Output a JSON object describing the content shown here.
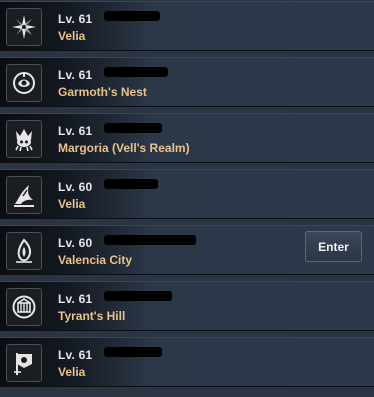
{
  "servers": [
    {
      "level": "Lv. 61",
      "name": "Velia",
      "icon": "star-compass-icon"
    },
    {
      "level": "Lv. 61",
      "name": "Garmoth's Nest",
      "icon": "dragon-eye-icon"
    },
    {
      "level": "Lv. 61",
      "name": "Margoria (Vell's Realm)",
      "icon": "kraken-crest-icon"
    },
    {
      "level": "Lv. 60",
      "name": "Velia",
      "icon": "wing-crest-icon"
    },
    {
      "level": "Lv. 60",
      "name": "Valencia City",
      "icon": "flame-crest-icon",
      "enter_label": "Enter"
    },
    {
      "level": "Lv. 61",
      "name": "Tyrant's Hill",
      "icon": "fortress-gate-icon"
    },
    {
      "level": "Lv. 61",
      "name": "Velia",
      "icon": "banner-crest-icon"
    }
  ],
  "colors": {
    "server_name": "#e9c38a",
    "level_text": "#e8e8e8"
  }
}
